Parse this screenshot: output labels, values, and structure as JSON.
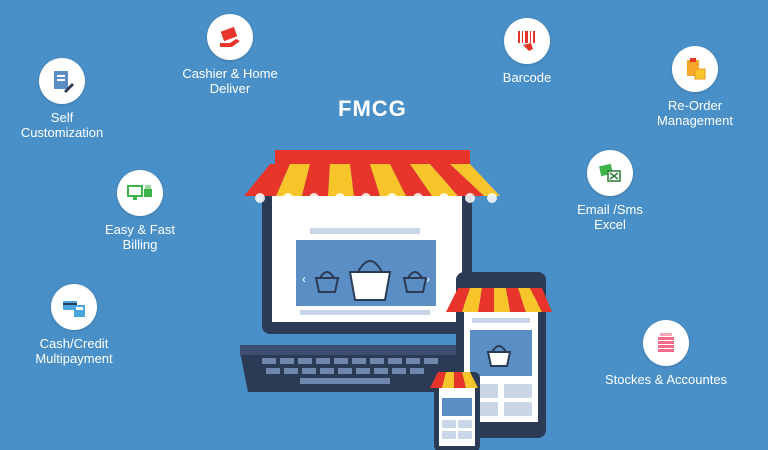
{
  "title": "FMCG",
  "features": [
    {
      "id": "self-customization",
      "label": "Self\nCustomization",
      "icon": "document-edit-icon"
    },
    {
      "id": "cashier-home-deliver",
      "label": "Cashier & Home\nDeliver",
      "icon": "delivery-hand-icon"
    },
    {
      "id": "barcode",
      "label": "Barcode",
      "icon": "barcode-scanner-icon"
    },
    {
      "id": "reorder-management",
      "label": "Re-Order\nManagement",
      "icon": "clipboard-box-icon"
    },
    {
      "id": "easy-fast-billing",
      "label": "Easy & Fast\nBilling",
      "icon": "computer-printer-icon"
    },
    {
      "id": "email-sms-excel",
      "label": "Email /Sms\nExcel",
      "icon": "spreadsheet-icon"
    },
    {
      "id": "cash-credit-multipayment",
      "label": "Cash/Credit\nMultipayment",
      "icon": "payment-icon"
    },
    {
      "id": "stocks-accounts",
      "label": "Stockes & Accountes",
      "icon": "stack-papers-icon"
    }
  ],
  "colors": {
    "background": "#4a90c8",
    "awning_red": "#e8352c",
    "awning_yellow": "#f7c52a",
    "device_dark": "#2b3a55",
    "screen": "#ffffff",
    "accent": "#5a8ec4"
  }
}
